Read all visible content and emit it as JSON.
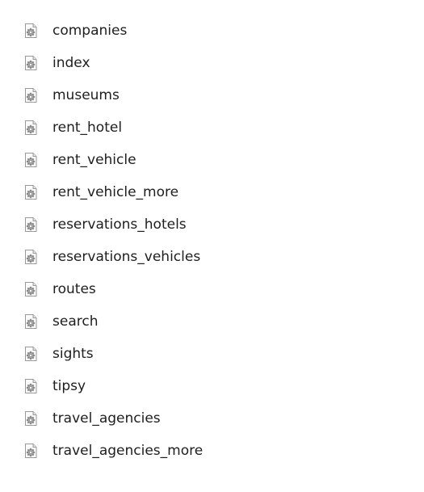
{
  "files": [
    {
      "name": "companies",
      "icon": "settings-file-icon"
    },
    {
      "name": "index",
      "icon": "settings-file-icon"
    },
    {
      "name": "museums",
      "icon": "settings-file-icon"
    },
    {
      "name": "rent_hotel",
      "icon": "settings-file-icon"
    },
    {
      "name": "rent_vehicle",
      "icon": "settings-file-icon"
    },
    {
      "name": "rent_vehicle_more",
      "icon": "settings-file-icon"
    },
    {
      "name": "reservations_hotels",
      "icon": "settings-file-icon"
    },
    {
      "name": "reservations_vehicles",
      "icon": "settings-file-icon"
    },
    {
      "name": "routes",
      "icon": "settings-file-icon"
    },
    {
      "name": "search",
      "icon": "settings-file-icon"
    },
    {
      "name": "sights",
      "icon": "settings-file-icon"
    },
    {
      "name": "tipsy",
      "icon": "settings-file-icon"
    },
    {
      "name": "travel_agencies",
      "icon": "settings-file-icon"
    },
    {
      "name": "travel_agencies_more",
      "icon": "settings-file-icon"
    }
  ]
}
